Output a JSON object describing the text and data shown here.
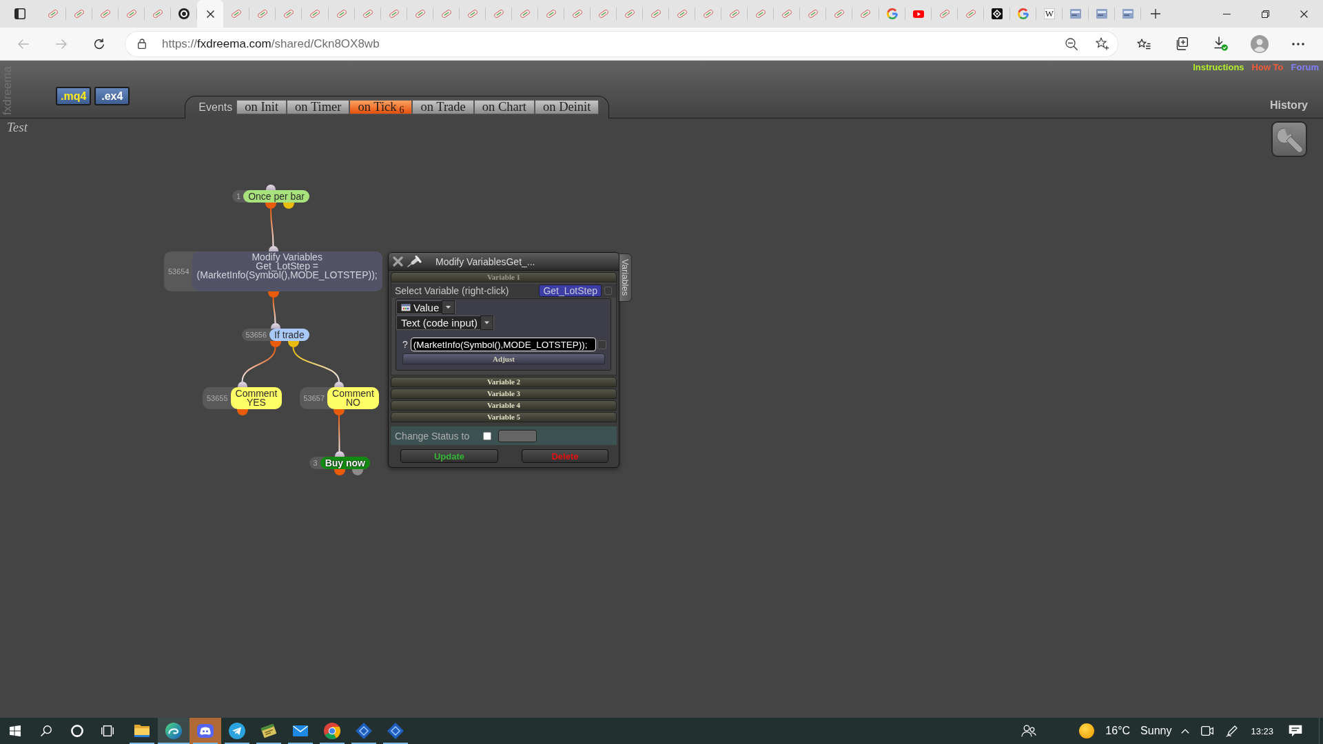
{
  "browser": {
    "tabs": [
      {
        "kind": "sketch",
        "selected": false
      },
      {
        "kind": "sketch",
        "selected": false
      },
      {
        "kind": "sketch",
        "selected": false
      },
      {
        "kind": "sketch",
        "selected": false
      },
      {
        "kind": "sketch",
        "selected": false
      },
      {
        "kind": "ring",
        "selected": false
      },
      {
        "selected": true
      },
      {
        "kind": "sketch",
        "selected": false
      },
      {
        "kind": "sketch",
        "selected": false
      },
      {
        "kind": "sketch",
        "selected": false
      },
      {
        "kind": "sketch",
        "selected": false
      },
      {
        "kind": "sketch",
        "selected": false
      },
      {
        "kind": "sketch",
        "selected": false
      },
      {
        "kind": "sketch",
        "selected": false
      },
      {
        "kind": "sketch",
        "selected": false
      },
      {
        "kind": "sketch",
        "selected": false
      },
      {
        "kind": "sketch",
        "selected": false
      },
      {
        "kind": "sketch",
        "selected": false
      },
      {
        "kind": "sketch",
        "selected": false
      },
      {
        "kind": "sketch",
        "selected": false
      },
      {
        "kind": "sketch",
        "selected": false
      },
      {
        "kind": "sketch",
        "selected": false
      },
      {
        "kind": "sketch",
        "selected": false
      },
      {
        "kind": "sketch",
        "selected": false
      },
      {
        "kind": "sketch",
        "selected": false
      },
      {
        "kind": "sketch",
        "selected": false
      },
      {
        "kind": "sketch",
        "selected": false
      },
      {
        "kind": "sketch",
        "selected": false
      },
      {
        "kind": "sketch",
        "selected": false
      },
      {
        "kind": "sketch",
        "selected": false
      },
      {
        "kind": "sketch",
        "selected": false
      },
      {
        "kind": "sketch",
        "selected": false
      },
      {
        "kind": "arcs",
        "selected": false
      },
      {
        "kind": "play",
        "selected": false
      },
      {
        "kind": "sketch",
        "selected": false
      },
      {
        "kind": "sketch",
        "selected": false
      },
      {
        "kind": "diamond",
        "selected": false
      },
      {
        "kind": "arcs",
        "selected": false
      },
      {
        "kind": "letter",
        "glyph": "W",
        "selected": false
      },
      {
        "kind": "tile",
        "selected": false
      },
      {
        "kind": "tile",
        "selected": false
      },
      {
        "kind": "tile",
        "selected": false
      }
    ],
    "nav": [
      {
        "kind": "back",
        "disabled": true
      },
      {
        "kind": "forward",
        "disabled": true
      },
      {
        "kind": "reload",
        "disabled": false
      }
    ],
    "address": {
      "scheme": "https://",
      "host": "fxdreema.com",
      "path": "/shared/Ckn8OX8wb"
    }
  },
  "app": {
    "brand": "fxdreema",
    "export_buttons": [
      {
        "label": ".mq4",
        "selected": true
      },
      {
        "label": ".ex4",
        "selected": false
      }
    ],
    "events": {
      "label": "Events",
      "tabs": [
        {
          "label": "on Init",
          "selected": false
        },
        {
          "label": "on Timer",
          "selected": false
        },
        {
          "label": "on Tick",
          "count": "6",
          "selected": true
        },
        {
          "label": "on Trade",
          "selected": false
        },
        {
          "label": "on Chart",
          "selected": false
        },
        {
          "label": "on Deinit",
          "selected": false
        }
      ]
    },
    "links": [
      {
        "label": "Instructions",
        "color": "#b4f02a"
      },
      {
        "label": "How To",
        "color": "#f25a3a"
      },
      {
        "label": "Forum",
        "color": "#8481ff"
      }
    ],
    "history": "History",
    "project_title": "Test",
    "blocks": [
      {
        "number": "1",
        "kind": "block",
        "lines": [
          "Once per bar"
        ],
        "color": "#a8e27c",
        "outputs": [
          {
            "color": "#e85c0c",
            "children": [
              {
                "number": "53654",
                "kind": "block",
                "lines": [
                  "Modify Variables",
                  "Get_LotStep =",
                  "(MarketInfo(Symbol(),MODE_LOTSTEP));"
                ],
                "color": "#535368",
                "outputs": [
                  {
                    "color": "#e85c0c",
                    "children": [
                      {
                        "number": "53656",
                        "kind": "block",
                        "lines": [
                          "If trade"
                        ],
                        "color": "#a9c9fa",
                        "outputs": [
                          {
                            "color": "#e85c0c",
                            "children": [
                              {
                                "number": "53655",
                                "kind": "block",
                                "lines": [
                                  "Comment",
                                  "YES"
                                ],
                                "color": "#ffff66",
                                "outputs": [
                                  {
                                    "color": "#e85c0c"
                                  }
                                ]
                              }
                            ]
                          },
                          {
                            "color": "#e8bc0c",
                            "children": [
                              {
                                "number": "53657",
                                "kind": "block",
                                "lines": [
                                  "Comment",
                                  "NO"
                                ],
                                "color": "#ffff66",
                                "outputs": [
                                  {
                                    "color": "#e85c0c",
                                    "children": [
                                      {
                                        "number": "3",
                                        "kind": "trade",
                                        "lines": [
                                          "Buy now"
                                        ],
                                        "color": "#128a12",
                                        "outputs": [
                                          {
                                            "color": "#e85c0c"
                                          },
                                          {
                                            "color": "#8c8c8c"
                                          }
                                        ]
                                      }
                                    ]
                                  }
                                ]
                              }
                            ]
                          }
                        ]
                      }
                    ]
                  }
                ]
              }
            ]
          },
          {
            "color": "#e8bc0c"
          }
        ]
      }
    ],
    "dialog": {
      "title": "Modify VariablesGet_...",
      "side_tab": "Variables",
      "sections": [
        {
          "title": "Variable 1",
          "expanded": true,
          "select_label": "Select Variable (right-click)",
          "variable": "Get_LotStep",
          "variable_checked": false,
          "value_type": "Value",
          "input_mode": "Text (code input)",
          "hint": "?",
          "value": "(MarketInfo(Symbol(),MODE_LOTSTEP));",
          "value_checked": false,
          "adjust": "Adjust"
        },
        {
          "title": "Variable 2",
          "expanded": false
        },
        {
          "title": "Variable 3",
          "expanded": false
        },
        {
          "title": "Variable 4",
          "expanded": false
        },
        {
          "title": "Variable 5",
          "expanded": false
        }
      ],
      "status": {
        "label": "Change Status to",
        "checked": false
      },
      "buttons": [
        {
          "label": "Update",
          "kind": "update"
        },
        {
          "label": "Delete",
          "kind": "delete"
        }
      ]
    }
  },
  "taskbar": {
    "apps": [
      {
        "kind": "folder",
        "running": true,
        "selected": false,
        "flashing": false
      },
      {
        "kind": "swirl",
        "running": true,
        "selected": true,
        "flashing": false
      },
      {
        "kind": "gamepad",
        "running": true,
        "selected": false,
        "flashing": true
      },
      {
        "kind": "paper-plane",
        "running": true,
        "selected": false,
        "flashing": false
      },
      {
        "kind": "card",
        "running": true,
        "selected": false,
        "flashing": false
      },
      {
        "kind": "envelope",
        "running": true,
        "selected": false,
        "flashing": false
      },
      {
        "kind": "wheel",
        "running": true,
        "selected": false,
        "flashing": false
      },
      {
        "kind": "diamond",
        "running": true,
        "selected": false,
        "flashing": false
      },
      {
        "kind": "diamond",
        "running": true,
        "selected": false,
        "flashing": false
      }
    ],
    "weather": {
      "temperature": "16°C",
      "condition": "Sunny"
    },
    "clock": "13:23"
  }
}
